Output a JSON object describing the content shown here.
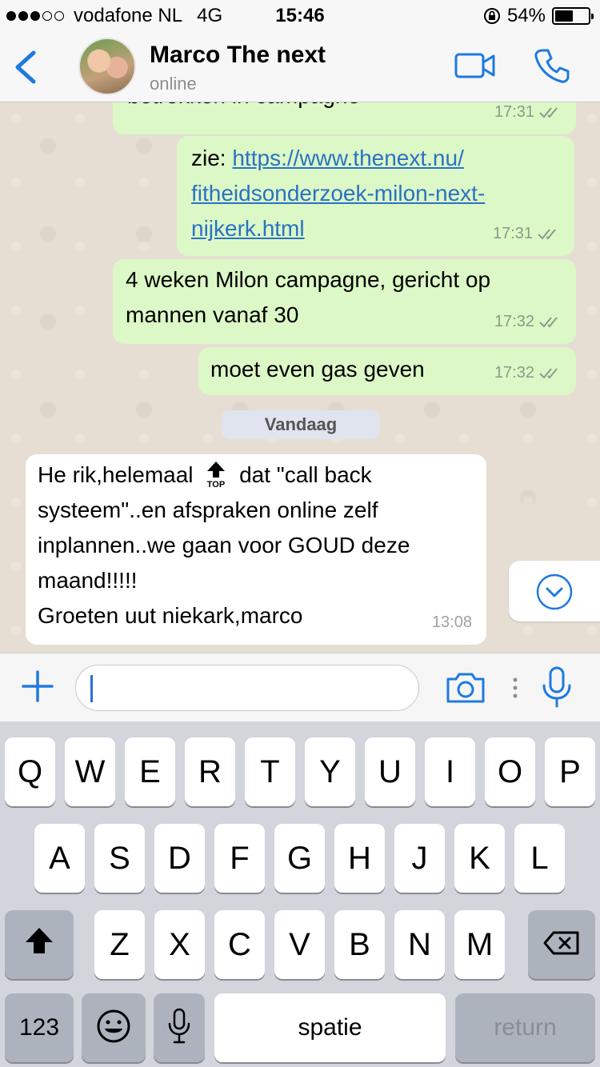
{
  "status_bar": {
    "carrier": "vodafone NL",
    "network": "4G",
    "time": "15:46",
    "battery": "54%",
    "battery_level": 0.54
  },
  "header": {
    "contact_name": "Marco The next",
    "contact_status": "online",
    "accent_color": "#1e7ae0"
  },
  "messages": [
    {
      "direction": "out",
      "text": "betrekken in campagne",
      "time": "17:31",
      "read": true
    },
    {
      "direction": "out",
      "prefix": "zie: ",
      "link_lines": [
        "https://www.thenext.nu/",
        "fitheidsonderzoek-milon-next-",
        "nijkerk.html"
      ],
      "time": "17:31",
      "read": true
    },
    {
      "direction": "out",
      "lines": [
        "4 weken Milon campagne, gericht op",
        "mannen vanaf 30"
      ],
      "time": "17:32",
      "read": true
    },
    {
      "direction": "out",
      "text": "moet even gas geven",
      "time": "17:32",
      "read": true
    },
    {
      "direction": "in",
      "line1_start": "He rik,helemaal",
      "emoji": "top-arrow-emoji",
      "emoji_label": "TOP",
      "line1_end": "dat \"call back",
      "lines": [
        "systeem\"..en afspraken online zelf",
        "inplannen..we gaan voor GOUD deze",
        "maand!!!!!",
        "Groeten uut niekark,marco"
      ],
      "time": "13:08"
    }
  ],
  "day_separator": "Vandaag",
  "input": {
    "value": "",
    "placeholder": ""
  },
  "keyboard": {
    "row1": [
      "Q",
      "W",
      "E",
      "R",
      "T",
      "Y",
      "U",
      "I",
      "O",
      "P"
    ],
    "row2": [
      "A",
      "S",
      "D",
      "F",
      "G",
      "H",
      "J",
      "K",
      "L"
    ],
    "row3": [
      "Z",
      "X",
      "C",
      "V",
      "B",
      "N",
      "M"
    ],
    "numbers_key": "123",
    "space_key": "spatie",
    "return_key": "return"
  },
  "icons": [
    "back-chevron-icon",
    "video-call-icon",
    "phone-icon",
    "scroll-down-icon",
    "plus-icon",
    "camera-icon",
    "more-dots-icon",
    "microphone-icon",
    "shift-icon",
    "backspace-icon",
    "emoji-icon",
    "dictation-mic-icon",
    "read-ticks-icon"
  ]
}
